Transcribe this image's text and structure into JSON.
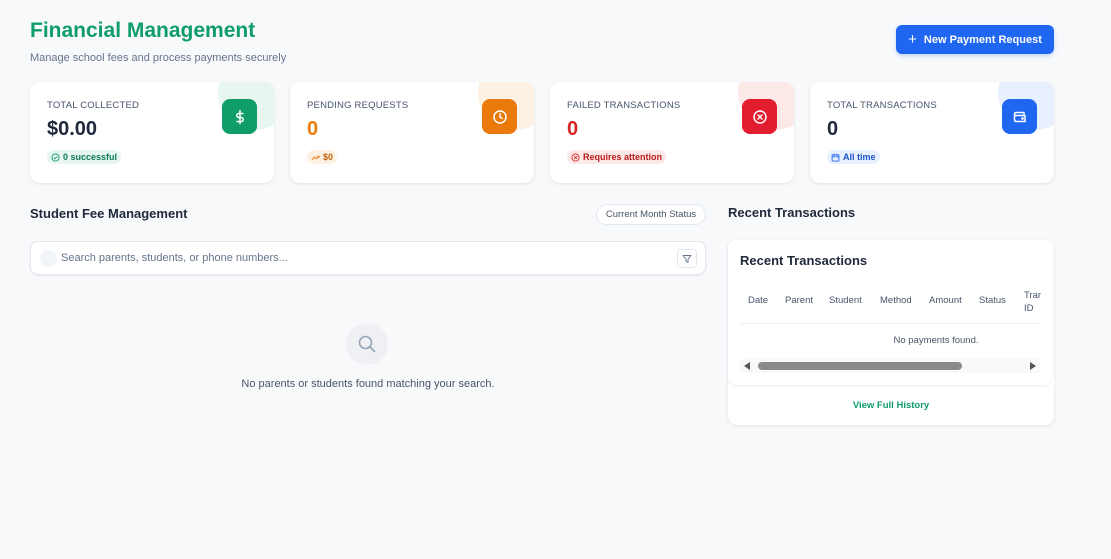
{
  "header": {
    "title": "Financial Management",
    "subtitle": "Manage school fees and process payments securely",
    "new_button_label": "New Payment Request"
  },
  "stats": [
    {
      "label": "TOTAL COLLECTED",
      "value": "$0.00",
      "badge": "0 successful",
      "icon": "dollar-icon",
      "color": "#0f9d6a"
    },
    {
      "label": "PENDING REQUESTS",
      "value": "0",
      "badge": "$0",
      "icon": "clock-icon",
      "color": "#ea7a0c"
    },
    {
      "label": "FAILED TRANSACTIONS",
      "value": "0",
      "badge": "Requires attention",
      "icon": "x-circle-icon",
      "color": "#dc2626"
    },
    {
      "label": "TOTAL TRANSACTIONS",
      "value": "0",
      "badge": "All time",
      "icon": "wallet-icon",
      "color": "#1f66f0"
    }
  ],
  "fees": {
    "title": "Student Fee Management",
    "status_label": "Current Month Status",
    "search_placeholder": "Search parents, students, or phone numbers...",
    "empty_text": "No parents or students found matching your search."
  },
  "transactions": {
    "section_title": "Recent Transactions",
    "panel_title": "Recent Transactions",
    "columns": [
      "Date",
      "Parent",
      "Student",
      "Method",
      "Amount",
      "Status"
    ],
    "last_column_top": "Trar",
    "last_column_bottom": "ID",
    "empty_text": "No payments found.",
    "view_history": "View Full History"
  }
}
